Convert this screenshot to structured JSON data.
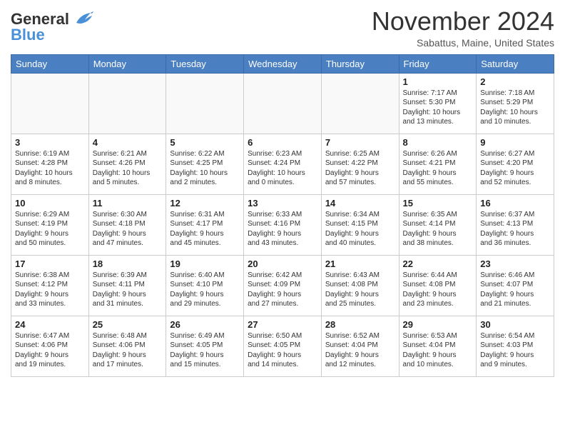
{
  "logo": {
    "line1": "General",
    "line2": "Blue"
  },
  "title": "November 2024",
  "subtitle": "Sabattus, Maine, United States",
  "weekdays": [
    "Sunday",
    "Monday",
    "Tuesday",
    "Wednesday",
    "Thursday",
    "Friday",
    "Saturday"
  ],
  "weeks": [
    [
      {
        "day": "",
        "info": ""
      },
      {
        "day": "",
        "info": ""
      },
      {
        "day": "",
        "info": ""
      },
      {
        "day": "",
        "info": ""
      },
      {
        "day": "",
        "info": ""
      },
      {
        "day": "1",
        "info": "Sunrise: 7:17 AM\nSunset: 5:30 PM\nDaylight: 10 hours\nand 13 minutes."
      },
      {
        "day": "2",
        "info": "Sunrise: 7:18 AM\nSunset: 5:29 PM\nDaylight: 10 hours\nand 10 minutes."
      }
    ],
    [
      {
        "day": "3",
        "info": "Sunrise: 6:19 AM\nSunset: 4:28 PM\nDaylight: 10 hours\nand 8 minutes."
      },
      {
        "day": "4",
        "info": "Sunrise: 6:21 AM\nSunset: 4:26 PM\nDaylight: 10 hours\nand 5 minutes."
      },
      {
        "day": "5",
        "info": "Sunrise: 6:22 AM\nSunset: 4:25 PM\nDaylight: 10 hours\nand 2 minutes."
      },
      {
        "day": "6",
        "info": "Sunrise: 6:23 AM\nSunset: 4:24 PM\nDaylight: 10 hours\nand 0 minutes."
      },
      {
        "day": "7",
        "info": "Sunrise: 6:25 AM\nSunset: 4:22 PM\nDaylight: 9 hours\nand 57 minutes."
      },
      {
        "day": "8",
        "info": "Sunrise: 6:26 AM\nSunset: 4:21 PM\nDaylight: 9 hours\nand 55 minutes."
      },
      {
        "day": "9",
        "info": "Sunrise: 6:27 AM\nSunset: 4:20 PM\nDaylight: 9 hours\nand 52 minutes."
      }
    ],
    [
      {
        "day": "10",
        "info": "Sunrise: 6:29 AM\nSunset: 4:19 PM\nDaylight: 9 hours\nand 50 minutes."
      },
      {
        "day": "11",
        "info": "Sunrise: 6:30 AM\nSunset: 4:18 PM\nDaylight: 9 hours\nand 47 minutes."
      },
      {
        "day": "12",
        "info": "Sunrise: 6:31 AM\nSunset: 4:17 PM\nDaylight: 9 hours\nand 45 minutes."
      },
      {
        "day": "13",
        "info": "Sunrise: 6:33 AM\nSunset: 4:16 PM\nDaylight: 9 hours\nand 43 minutes."
      },
      {
        "day": "14",
        "info": "Sunrise: 6:34 AM\nSunset: 4:15 PM\nDaylight: 9 hours\nand 40 minutes."
      },
      {
        "day": "15",
        "info": "Sunrise: 6:35 AM\nSunset: 4:14 PM\nDaylight: 9 hours\nand 38 minutes."
      },
      {
        "day": "16",
        "info": "Sunrise: 6:37 AM\nSunset: 4:13 PM\nDaylight: 9 hours\nand 36 minutes."
      }
    ],
    [
      {
        "day": "17",
        "info": "Sunrise: 6:38 AM\nSunset: 4:12 PM\nDaylight: 9 hours\nand 33 minutes."
      },
      {
        "day": "18",
        "info": "Sunrise: 6:39 AM\nSunset: 4:11 PM\nDaylight: 9 hours\nand 31 minutes."
      },
      {
        "day": "19",
        "info": "Sunrise: 6:40 AM\nSunset: 4:10 PM\nDaylight: 9 hours\nand 29 minutes."
      },
      {
        "day": "20",
        "info": "Sunrise: 6:42 AM\nSunset: 4:09 PM\nDaylight: 9 hours\nand 27 minutes."
      },
      {
        "day": "21",
        "info": "Sunrise: 6:43 AM\nSunset: 4:08 PM\nDaylight: 9 hours\nand 25 minutes."
      },
      {
        "day": "22",
        "info": "Sunrise: 6:44 AM\nSunset: 4:08 PM\nDaylight: 9 hours\nand 23 minutes."
      },
      {
        "day": "23",
        "info": "Sunrise: 6:46 AM\nSunset: 4:07 PM\nDaylight: 9 hours\nand 21 minutes."
      }
    ],
    [
      {
        "day": "24",
        "info": "Sunrise: 6:47 AM\nSunset: 4:06 PM\nDaylight: 9 hours\nand 19 minutes."
      },
      {
        "day": "25",
        "info": "Sunrise: 6:48 AM\nSunset: 4:06 PM\nDaylight: 9 hours\nand 17 minutes."
      },
      {
        "day": "26",
        "info": "Sunrise: 6:49 AM\nSunset: 4:05 PM\nDaylight: 9 hours\nand 15 minutes."
      },
      {
        "day": "27",
        "info": "Sunrise: 6:50 AM\nSunset: 4:05 PM\nDaylight: 9 hours\nand 14 minutes."
      },
      {
        "day": "28",
        "info": "Sunrise: 6:52 AM\nSunset: 4:04 PM\nDaylight: 9 hours\nand 12 minutes."
      },
      {
        "day": "29",
        "info": "Sunrise: 6:53 AM\nSunset: 4:04 PM\nDaylight: 9 hours\nand 10 minutes."
      },
      {
        "day": "30",
        "info": "Sunrise: 6:54 AM\nSunset: 4:03 PM\nDaylight: 9 hours\nand 9 minutes."
      }
    ]
  ]
}
